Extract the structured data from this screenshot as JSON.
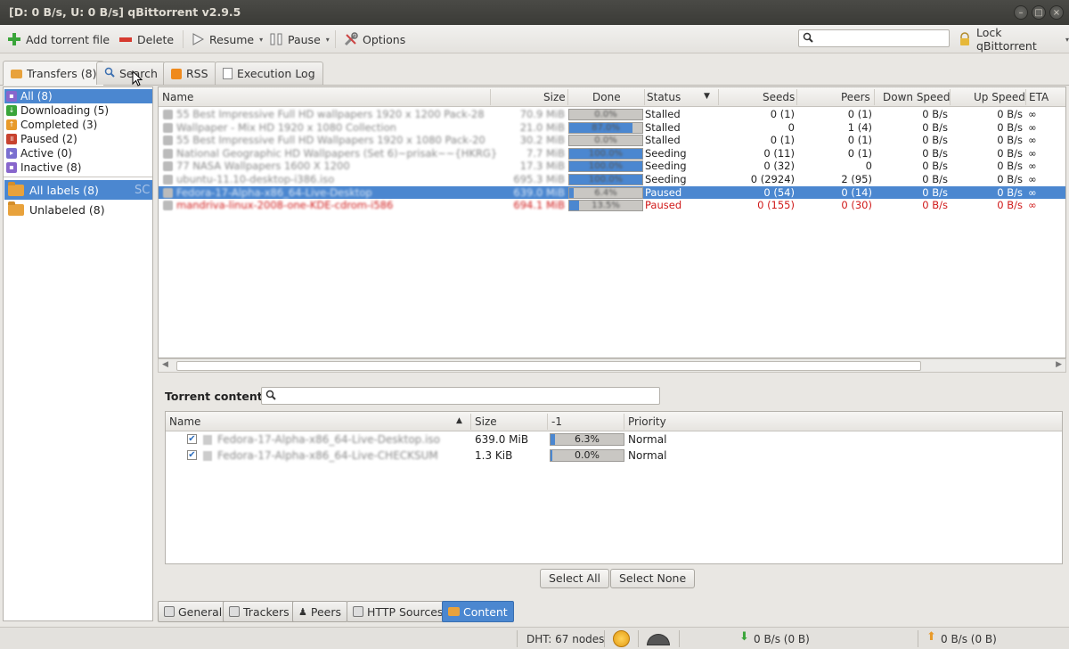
{
  "window": {
    "title": "[D: 0 B/s, U: 0 B/s] qBittorrent v2.9.5"
  },
  "toolbar": {
    "add_torrent": "Add torrent file",
    "delete": "Delete",
    "resume": "Resume",
    "pause": "Pause",
    "options": "Options",
    "search_placeholder": "",
    "lock": "Lock qBittorrent"
  },
  "tabs": [
    "Transfers (8)",
    "Search",
    "RSS",
    "Execution Log"
  ],
  "sidebar": {
    "filters": [
      "All (8)",
      "Downloading (5)",
      "Completed (3)",
      "Paused (2)",
      "Active (0)",
      "Inactive (8)"
    ],
    "labels": [
      "All labels (8)",
      "Unlabeled (8)"
    ],
    "overflow_text": "SC"
  },
  "transfer_list": {
    "columns": [
      "Name",
      "Size",
      "Done",
      "Status",
      "Seeds",
      "Peers",
      "Down Speed",
      "Up Speed",
      "ETA"
    ],
    "rows": [
      {
        "name": "55 Best Impressive Full HD wallpapers 1920 x 1200 Pack-28",
        "size": "70.9 MiB",
        "done": 0.0,
        "done_label": "0.0%",
        "status": "Stalled",
        "seeds": "0 (1)",
        "peers": "0 (1)",
        "down": "0 B/s",
        "up": "0 B/s",
        "eta": "∞"
      },
      {
        "name": "Wallpaper - Mix HD 1920 x 1080 Collection",
        "size": "21.0 MiB",
        "done": 0.87,
        "done_label": "87.0%",
        "status": "Stalled",
        "seeds": "0",
        "peers": "1 (4)",
        "down": "0 B/s",
        "up": "0 B/s",
        "eta": "∞"
      },
      {
        "name": "55 Best Impressive Full HD Wallpapers 1920 x 1080 Pack-20",
        "size": "30.2 MiB",
        "done": 0.0,
        "done_label": "0.0%",
        "status": "Stalled",
        "seeds": "0 (1)",
        "peers": "0 (1)",
        "down": "0 B/s",
        "up": "0 B/s",
        "eta": "∞"
      },
      {
        "name": "National Geographic HD Wallpapers (Set 6)~prisak~~{HKRG}",
        "size": "7.7 MiB",
        "done": 1.0,
        "done_label": "100.0%",
        "status": "Seeding",
        "seeds": "0 (11)",
        "peers": "0 (1)",
        "down": "0 B/s",
        "up": "0 B/s",
        "eta": "∞"
      },
      {
        "name": "77 NASA Wallpapers 1600 X 1200",
        "size": "17.3 MiB",
        "done": 1.0,
        "done_label": "100.0%",
        "status": "Seeding",
        "seeds": "0 (32)",
        "peers": "0",
        "down": "0 B/s",
        "up": "0 B/s",
        "eta": "∞"
      },
      {
        "name": "ubuntu-11.10-desktop-i386.iso",
        "size": "695.3 MiB",
        "done": 1.0,
        "done_label": "100.0%",
        "status": "Seeding",
        "seeds": "0 (2924)",
        "peers": "2 (95)",
        "down": "0 B/s",
        "up": "0 B/s",
        "eta": "∞"
      },
      {
        "name": "Fedora-17-Alpha-x86_64-Live-Desktop",
        "size": "639.0 MiB",
        "done": 0.064,
        "done_label": "6.4%",
        "status": "Paused",
        "seeds": "0 (54)",
        "peers": "0 (14)",
        "down": "0 B/s",
        "up": "0 B/s",
        "eta": "∞",
        "selected": true
      },
      {
        "name": "mandriva-linux-2008-one-KDE-cdrom-i586",
        "size": "694.1 MiB",
        "done": 0.135,
        "done_label": "13.5%",
        "status": "Paused",
        "seeds": "0 (155)",
        "peers": "0 (30)",
        "down": "0 B/s",
        "up": "0 B/s",
        "eta": "∞",
        "red": true
      }
    ]
  },
  "content_panel": {
    "label": "Torrent content:",
    "columns": [
      "Name",
      "Size",
      "-1",
      "Priority"
    ],
    "files": [
      {
        "name": "Fedora-17-Alpha-x86_64-Live-Desktop.iso",
        "size": "639.0 MiB",
        "progress": 0.063,
        "progress_label": "6.3%",
        "priority": "Normal"
      },
      {
        "name": "Fedora-17-Alpha-x86_64-Live-CHECKSUM",
        "size": "1.3 KiB",
        "progress": 0.0,
        "progress_label": "0.0%",
        "priority": "Normal"
      }
    ],
    "select_all": "Select All",
    "select_none": "Select None"
  },
  "bottom_tabs": [
    "General",
    "Trackers",
    "Peers",
    "HTTP Sources",
    "Content"
  ],
  "status": {
    "dht": "DHT: 67 nodes",
    "down": "0 B/s (0 B)",
    "up": "0 B/s (0 B)"
  },
  "colors": {
    "selection": "#4b87d0",
    "paused_red": "#d01919"
  }
}
